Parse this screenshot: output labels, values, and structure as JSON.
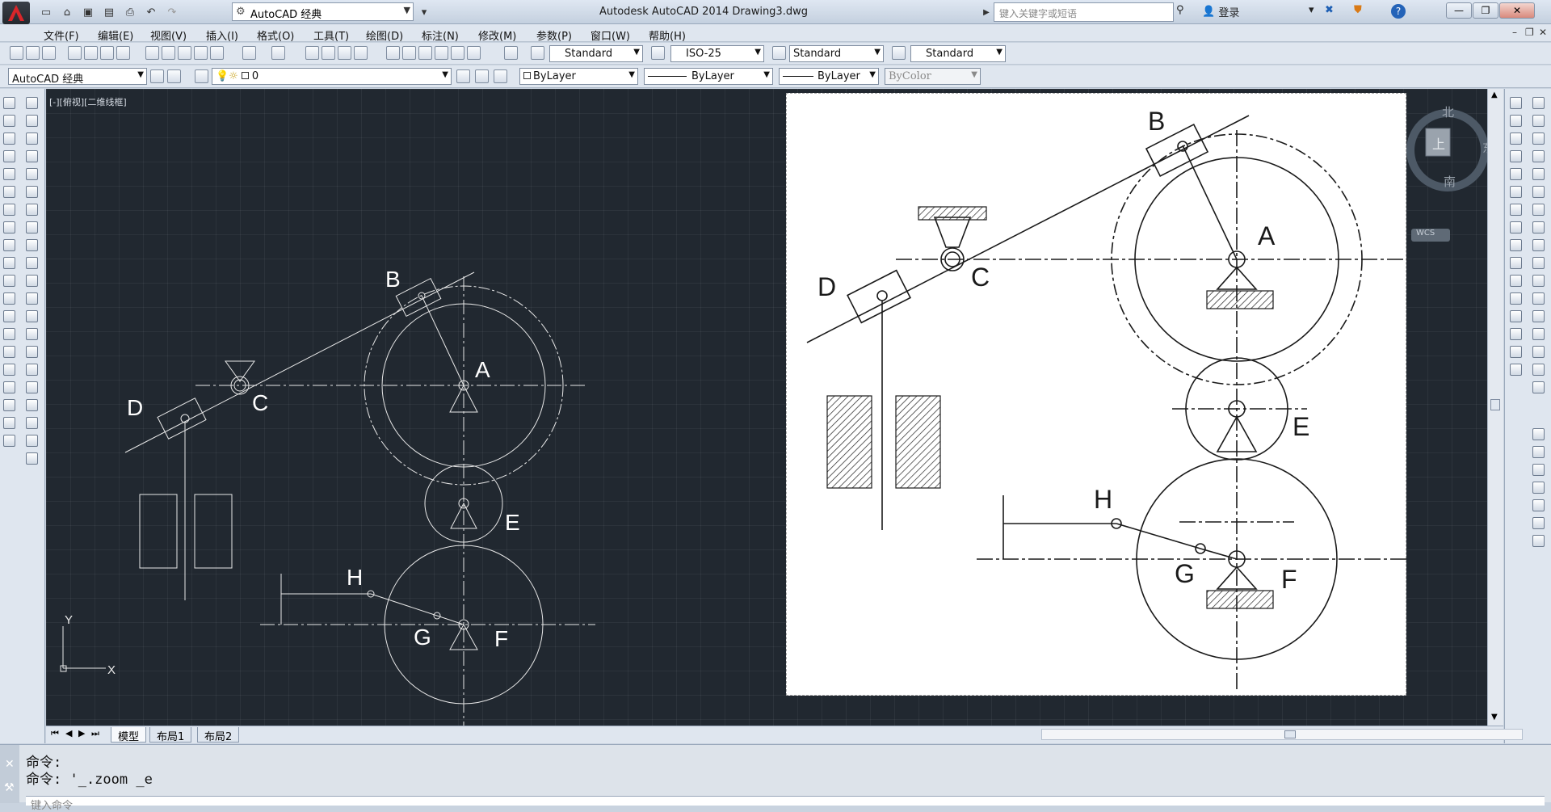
{
  "app": {
    "title": "Autodesk AutoCAD 2014    Drawing3.dwg",
    "workspace": "AutoCAD 经典",
    "search_placeholder": "键入关键字或短语",
    "login_label": "登录"
  },
  "menu": [
    "文件(F)",
    "编辑(E)",
    "视图(V)",
    "插入(I)",
    "格式(O)",
    "工具(T)",
    "绘图(D)",
    "标注(N)",
    "修改(M)",
    "参数(P)",
    "窗口(W)",
    "帮助(H)"
  ],
  "styles_toolbar": {
    "text_style": "Standard",
    "dim_style": "ISO-25",
    "table_style": "Standard",
    "multileader_style": "Standard"
  },
  "layers_toolbar": {
    "workspace": "AutoCAD 经典",
    "current_layer": "0",
    "color": "ByLayer",
    "linetype": "ByLayer",
    "lineweight": "ByLayer",
    "plot_style": "ByColor"
  },
  "viewport": {
    "label": "[-][俯视][二维线框]",
    "ucs_x": "X",
    "ucs_y": "Y"
  },
  "drawing": {
    "labels": {
      "A": "A",
      "B": "B",
      "C": "C",
      "D": "D",
      "E": "E",
      "F": "F",
      "G": "G",
      "H": "H"
    }
  },
  "viewcube": {
    "north": "北",
    "east": "东",
    "south": "南",
    "top": "上",
    "wcs": "WCS"
  },
  "layout_tabs": [
    "模型",
    "布局1",
    "布局2"
  ],
  "command": {
    "lines": [
      "命令:",
      "命令: '_.zoom _e"
    ],
    "input_placeholder": "键入命令"
  },
  "colors": {
    "canvas_bg": "#212830",
    "line_color": "#e8e8e8",
    "ui_bg": "#dfe6ef"
  }
}
